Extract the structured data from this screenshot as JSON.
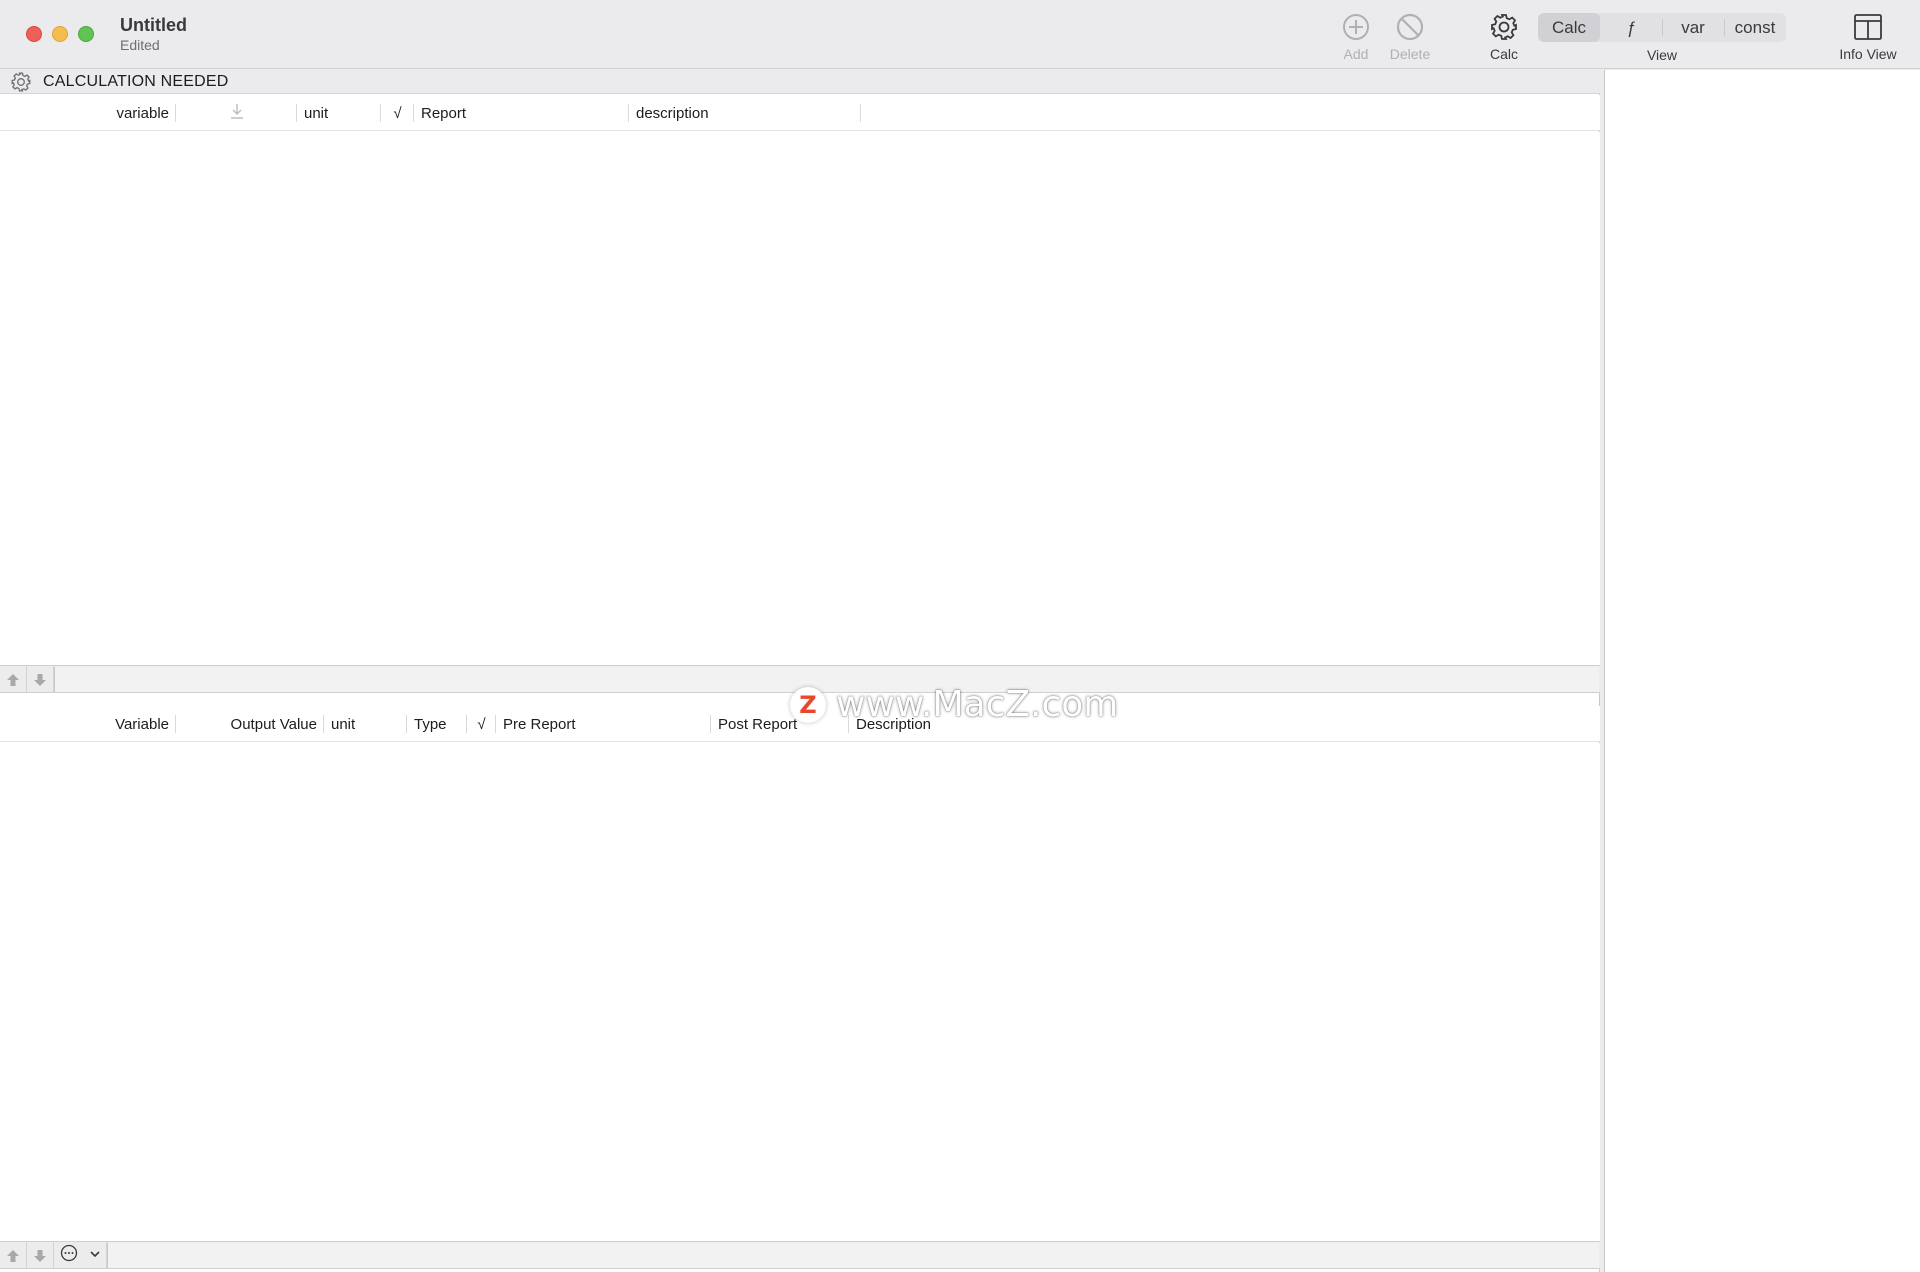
{
  "window": {
    "title": "Untitled",
    "subtitle": "Edited"
  },
  "toolbar": {
    "add_label": "Add",
    "delete_label": "Delete",
    "calc_label": "Calc",
    "view_segments": [
      "Calc",
      "ƒ",
      "var",
      "const"
    ],
    "view_selected": "Calc",
    "view_label": "View",
    "info_view_label": "Info View"
  },
  "status": {
    "text": "CALCULATION NEEDED"
  },
  "input_table": {
    "columns": [
      "variable",
      "",
      "unit",
      "√",
      "Report",
      "description"
    ],
    "rows": []
  },
  "output_table": {
    "columns": [
      "Variable",
      "Output Value",
      "unit",
      "Type",
      "√",
      "Pre Report",
      "Post Report",
      "Description"
    ],
    "rows": []
  },
  "watermark": {
    "logo_letter": "Z",
    "text": "www.MacZ.com"
  },
  "colors": {
    "close": "#ee5f57",
    "minimize": "#f5bd4f",
    "maximize": "#5fc454",
    "watermark_logo": "#e8472b"
  }
}
